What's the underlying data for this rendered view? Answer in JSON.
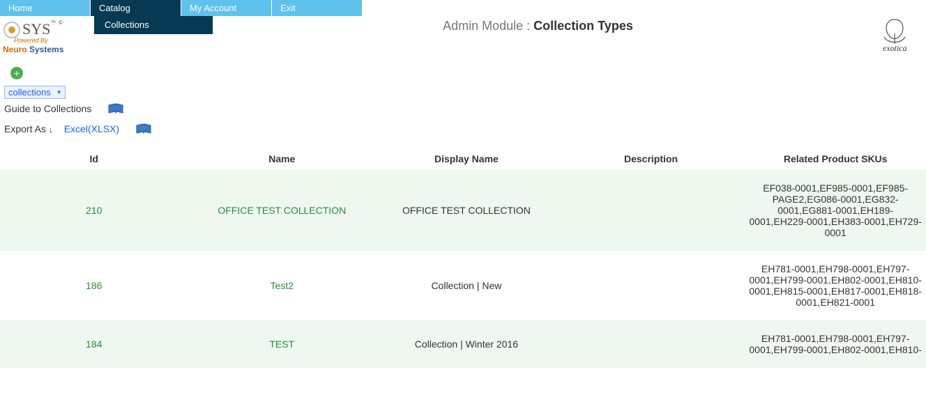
{
  "nav": {
    "items": [
      {
        "label": "Home",
        "active": false
      },
      {
        "label": "Catalog",
        "active": true
      },
      {
        "label": "My Account",
        "active": false
      },
      {
        "label": "Exit",
        "active": false
      }
    ],
    "subnav": {
      "label": "Collections"
    }
  },
  "logo": {
    "sys_text": "SYS",
    "tm": "™",
    "copyright": "©",
    "powered": "Powered By",
    "neuro": "Neuro",
    "systems": "Systems"
  },
  "right_logo": {
    "text": "exotica"
  },
  "header": {
    "prefix": "Admin Module : ",
    "title": "Collection Types"
  },
  "controls": {
    "dropdown_value": "collections",
    "guide_label": "Guide to Collections",
    "export_label": "Export As",
    "excel_label": "Excel(XLSX)"
  },
  "table": {
    "columns": [
      "Id",
      "Name",
      "Display Name",
      "Description",
      "Related Product SKUs"
    ],
    "rows": [
      {
        "id": "210",
        "name": "OFFICE TEST COLLECTION",
        "display": "OFFICE TEST COLLECTION",
        "description": "",
        "skus": "EF038-0001,EF985-0001,EF985-PAGE2,EG086-0001,EG832-0001,EG881-0001,EH189-0001,EH229-0001,EH383-0001,EH729-0001"
      },
      {
        "id": "186",
        "name": "Test2",
        "display": "Collection | New",
        "description": "",
        "skus": "EH781-0001,EH798-0001,EH797-0001,EH799-0001,EH802-0001,EH810-0001,EH815-0001,EH817-0001,EH818-0001,EH821-0001"
      },
      {
        "id": "184",
        "name": "TEST",
        "display": "Collection | Winter 2016",
        "description": "",
        "skus": "EH781-0001,EH798-0001,EH797-0001,EH799-0001,EH802-0001,EH810-"
      }
    ]
  }
}
